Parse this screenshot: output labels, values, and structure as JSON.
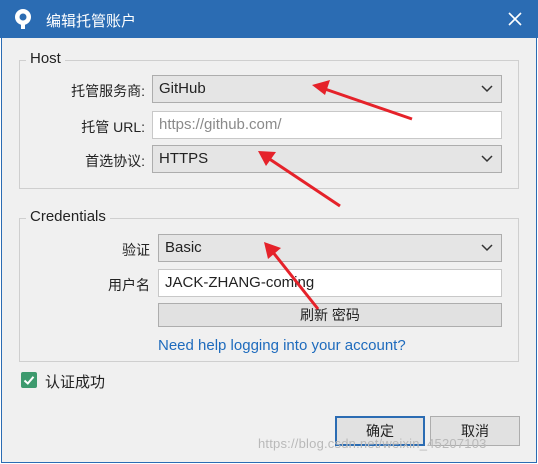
{
  "window": {
    "title": "编辑托管账户",
    "icon": "sourcetree-icon",
    "close_icon": "close-icon"
  },
  "host": {
    "legend": "Host",
    "provider_label": "托管服务商:",
    "provider_value": "GitHub",
    "url_label": "托管 URL:",
    "url_placeholder": "https://github.com/",
    "protocol_label": "首选协议:",
    "protocol_value": "HTTPS"
  },
  "credentials": {
    "legend": "Credentials",
    "auth_label": "验证",
    "auth_value": "Basic",
    "username_label": "用户名",
    "username_value": "JACK-ZHANG-coming",
    "refresh_password_label": "刷新 密码",
    "help_link": "Need help logging into your account?"
  },
  "auth_status": {
    "checked": true,
    "label": "认证成功"
  },
  "buttons": {
    "ok": "确定",
    "cancel": "取消"
  },
  "watermark": "https://blog.csdn.net/weixin_45207103",
  "colors": {
    "titlebar": "#2b6cb3",
    "link": "#1e6bbd",
    "checkbox": "#3d9a6e",
    "annotation_arrow": "#e5222a"
  }
}
